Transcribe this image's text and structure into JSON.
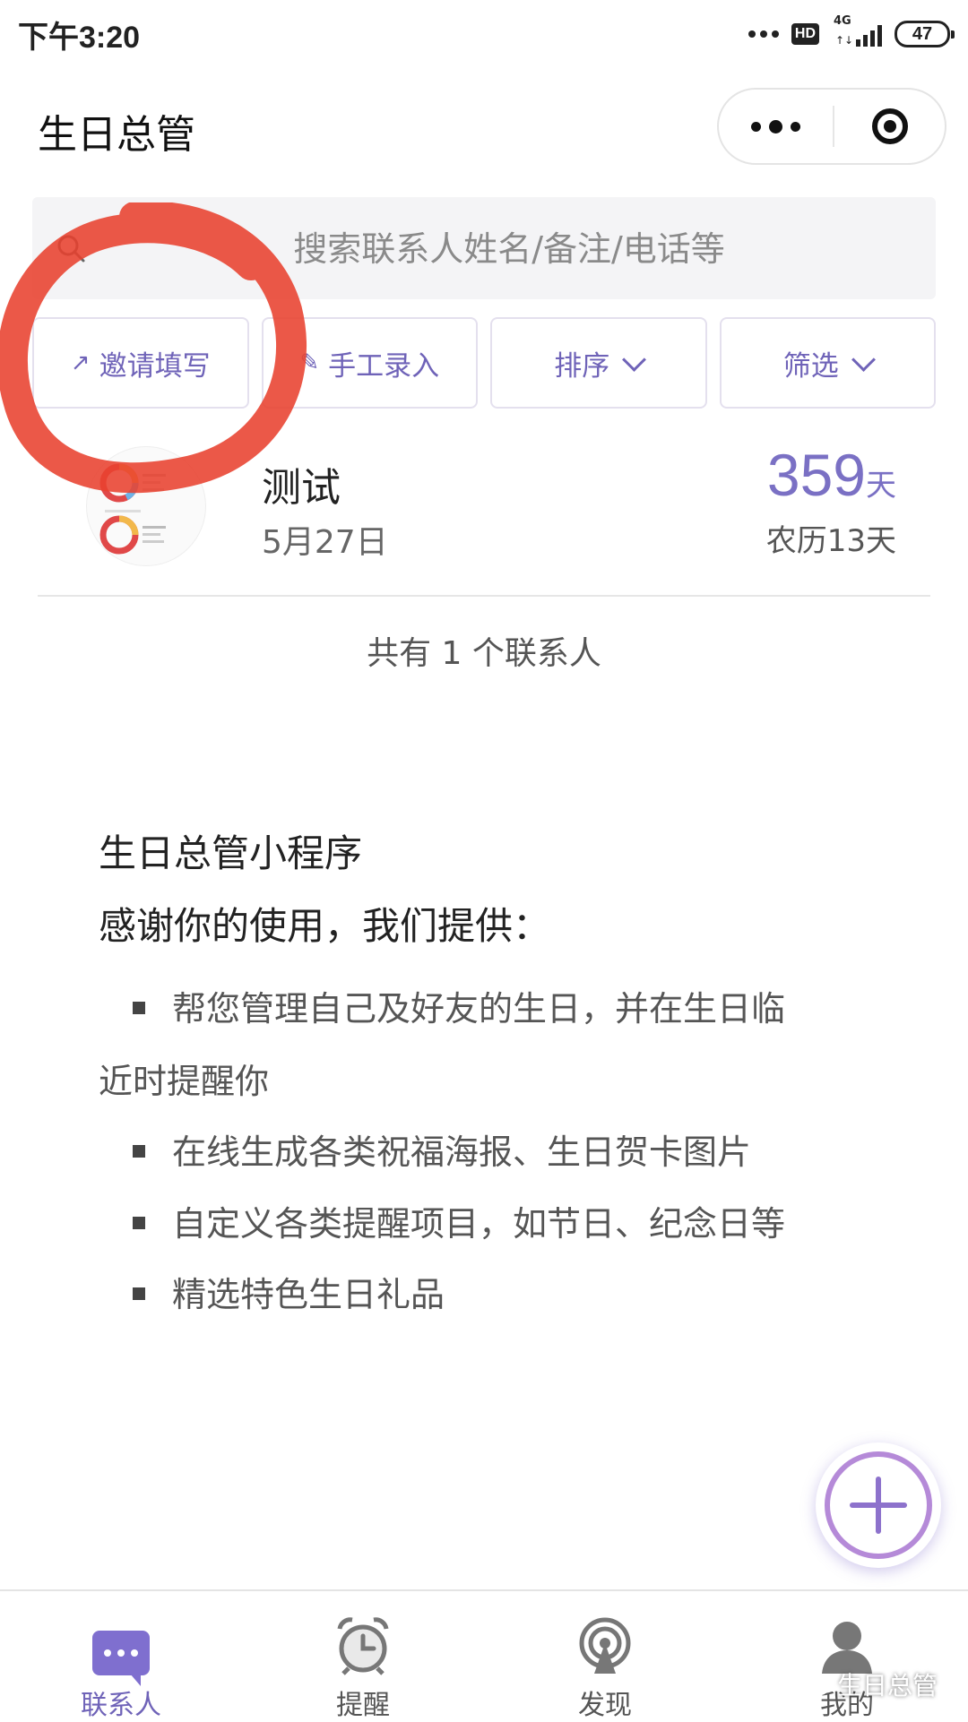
{
  "status_bar": {
    "time": "下午3:20",
    "hd_badge": "HD",
    "network": "4G",
    "network_arrows": "↑↓",
    "battery": "47"
  },
  "header": {
    "title": "生日总管"
  },
  "search": {
    "placeholder": "搜索联系人姓名/备注/电话等"
  },
  "actions": {
    "invite_label": "邀请填写",
    "manual_label": "手工录入",
    "sort_label": "排序",
    "filter_label": "筛选"
  },
  "contacts": [
    {
      "name": "测试",
      "date": "5月27日",
      "days": "359",
      "days_unit": "天",
      "lunar": "农历13天"
    }
  ],
  "contact_count": "共有 1 个联系人",
  "intro": {
    "title": "生日总管小程序",
    "subtitle": "感谢你的使用，我们提供：",
    "bullets": {
      "b1_line1": "帮您管理自己及好友的生日，并在生日临",
      "b1_line2": "近时提醒你",
      "b2": "在线生成各类祝福海报、生日贺卡图片",
      "b3": "自定义各类提醒项目，如节日、纪念日等",
      "b4": "精选特色生日礼品"
    }
  },
  "tabs": [
    {
      "label": "联系人",
      "icon": "chat-icon",
      "active": true
    },
    {
      "label": "提醒",
      "icon": "alarm-clock-icon",
      "active": false
    },
    {
      "label": "发现",
      "icon": "broadcast-icon",
      "active": false
    },
    {
      "label": "我的",
      "icon": "user-icon",
      "active": false
    }
  ],
  "watermark": "生日总管",
  "colors": {
    "accent": "#7a70c4",
    "annotation": "#e8412f"
  }
}
